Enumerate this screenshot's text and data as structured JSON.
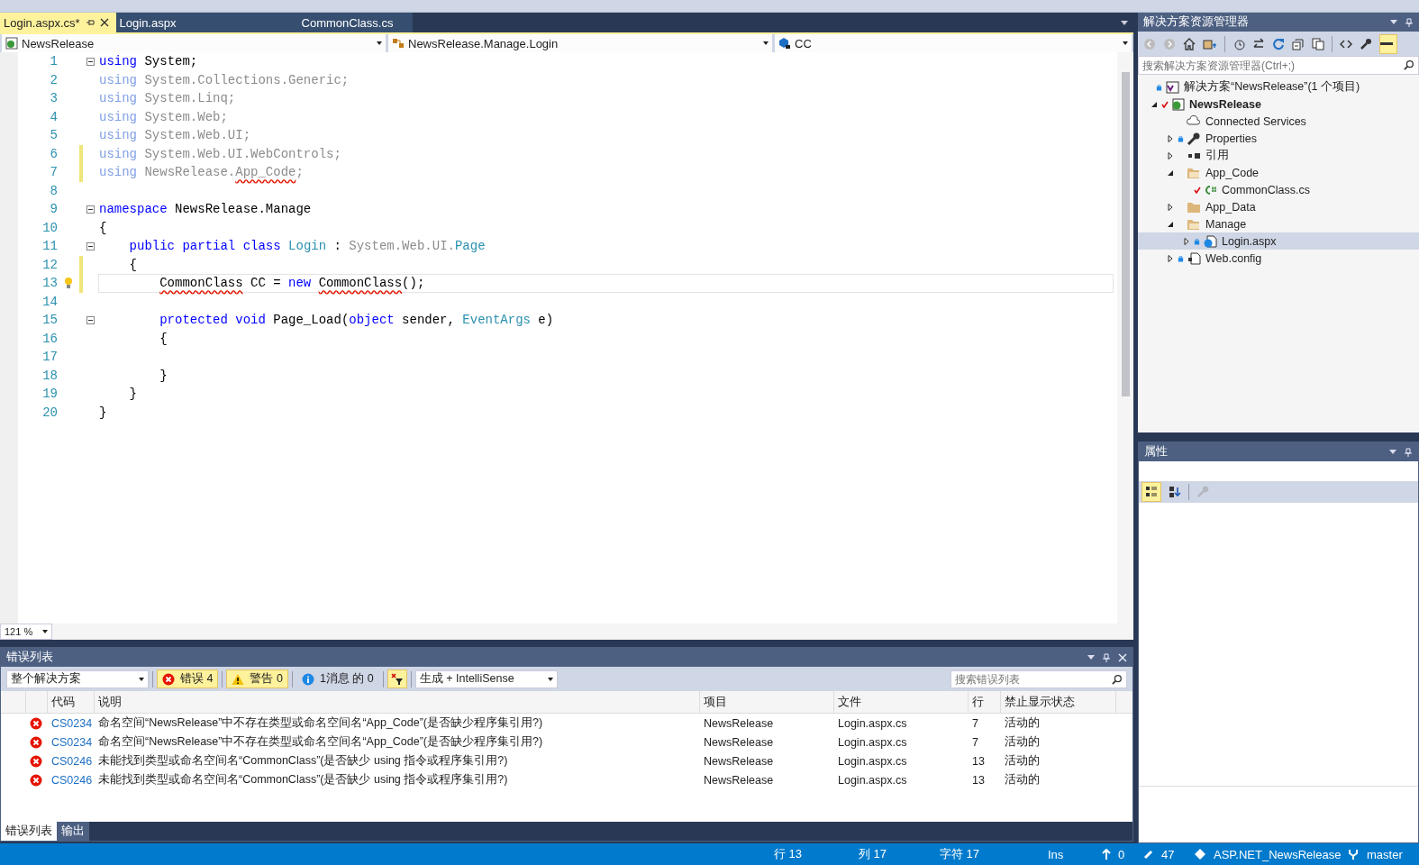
{
  "doc_tabs": [
    {
      "label": "Login.aspx.cs*",
      "selected": true
    },
    {
      "label": "Login.aspx",
      "selected": false
    },
    {
      "label": "CommonClass.cs",
      "selected": false
    }
  ],
  "nav": {
    "project": "NewsRelease",
    "type": "NewsRelease.Manage.Login",
    "member": "CC"
  },
  "code": [
    {
      "n": "1",
      "collapse": true,
      "modified": false,
      "current": false,
      "tokens": [
        {
          "text": "using",
          "kind": "kw"
        },
        {
          "text": " System;",
          "kind": "plain"
        }
      ]
    },
    {
      "n": "2",
      "collapse": false,
      "modified": false,
      "current": false,
      "tokens": [
        {
          "text": "using",
          "kind": "dimkw"
        },
        {
          "text": " System.Collections.Generic;",
          "kind": "dim"
        }
      ]
    },
    {
      "n": "3",
      "collapse": false,
      "modified": false,
      "current": false,
      "tokens": [
        {
          "text": "using",
          "kind": "dimkw"
        },
        {
          "text": " System.Linq;",
          "kind": "dim"
        }
      ]
    },
    {
      "n": "4",
      "collapse": false,
      "modified": false,
      "current": false,
      "tokens": [
        {
          "text": "using",
          "kind": "dimkw"
        },
        {
          "text": " System.Web;",
          "kind": "dim"
        }
      ]
    },
    {
      "n": "5",
      "collapse": false,
      "modified": false,
      "current": false,
      "tokens": [
        {
          "text": "using",
          "kind": "dimkw"
        },
        {
          "text": " System.Web.UI;",
          "kind": "dim"
        }
      ]
    },
    {
      "n": "6",
      "collapse": false,
      "modified": true,
      "current": false,
      "tokens": [
        {
          "text": "using",
          "kind": "dimkw"
        },
        {
          "text": " System.Web.UI.WebControls;",
          "kind": "dim"
        }
      ]
    },
    {
      "n": "7",
      "collapse": false,
      "modified": true,
      "current": false,
      "tokens": [
        {
          "text": "using",
          "kind": "dimkw"
        },
        {
          "text": " NewsRelease.",
          "kind": "dim"
        },
        {
          "text": "App_Code",
          "kind": "dimerr"
        },
        {
          "text": ";",
          "kind": "dim"
        }
      ]
    },
    {
      "n": "8",
      "collapse": false,
      "modified": false,
      "current": false
    },
    {
      "n": "9",
      "collapse": true,
      "modified": false,
      "current": false,
      "tokens": [
        {
          "text": "namespace",
          "kind": "kw"
        },
        {
          "text": " NewsRelease.Manage",
          "kind": "plain"
        }
      ]
    },
    {
      "n": "10",
      "collapse": false,
      "modified": false,
      "current": false,
      "tokens": [
        {
          "text": "{",
          "kind": "plain"
        }
      ]
    },
    {
      "n": "11",
      "collapse": true,
      "modified": false,
      "current": false,
      "tokens": [
        {
          "text": "    public",
          "kind": "kw"
        },
        {
          "text": " partial",
          "kind": "kw"
        },
        {
          "text": " class",
          "kind": "kw"
        },
        {
          "text": " Login",
          "kind": "type"
        },
        {
          "text": " : ",
          "kind": "plain"
        },
        {
          "text": "System.Web.UI.",
          "kind": "dim"
        },
        {
          "text": "Page",
          "kind": "type"
        }
      ]
    },
    {
      "n": "12",
      "collapse": false,
      "modified": true,
      "current": false,
      "tokens": [
        {
          "text": "    {",
          "kind": "plain"
        }
      ]
    },
    {
      "n": "13",
      "collapse": false,
      "modified": true,
      "current": true,
      "lightbulb": true,
      "tokens": [
        {
          "text": "        CommonClass",
          "kind": "err"
        },
        {
          "text": " CC = ",
          "kind": "plain"
        },
        {
          "text": "new",
          "kind": "kw"
        },
        {
          "text": " CommonClass",
          "kind": "err"
        },
        {
          "text": "();",
          "kind": "plain"
        }
      ]
    },
    {
      "n": "14",
      "collapse": false,
      "modified": false,
      "current": false
    },
    {
      "n": "15",
      "collapse": true,
      "modified": false,
      "current": false,
      "tokens": [
        {
          "text": "        protected",
          "kind": "kw"
        },
        {
          "text": " void",
          "kind": "kw"
        },
        {
          "text": " Page_Load(",
          "kind": "plain"
        },
        {
          "text": "object",
          "kind": "kw"
        },
        {
          "text": " sender, ",
          "kind": "plain"
        },
        {
          "text": "EventArgs",
          "kind": "type"
        },
        {
          "text": " e)",
          "kind": "plain"
        }
      ]
    },
    {
      "n": "16",
      "collapse": false,
      "modified": false,
      "current": false,
      "tokens": [
        {
          "text": "        {",
          "kind": "plain"
        }
      ]
    },
    {
      "n": "17",
      "collapse": false,
      "modified": false,
      "current": false
    },
    {
      "n": "18",
      "collapse": false,
      "modified": false,
      "current": false,
      "tokens": [
        {
          "text": "        }",
          "kind": "plain"
        }
      ]
    },
    {
      "n": "19",
      "collapse": false,
      "modified": false,
      "current": false,
      "tokens": [
        {
          "text": "    }",
          "kind": "plain"
        }
      ]
    },
    {
      "n": "20",
      "collapse": false,
      "modified": false,
      "current": false,
      "tokens": [
        {
          "text": "}",
          "kind": "plain"
        }
      ]
    }
  ],
  "zoom": "121 %",
  "solution_explorer": {
    "title": "解决方案资源管理器",
    "search_placeholder": "搜索解决方案资源管理器(Ctrl+;)",
    "tree": [
      {
        "label": "解决方案“NewsRelease”(1 个项目)",
        "kind": "solution",
        "locked": true,
        "changed": false,
        "selected": false,
        "children": [
          {
            "label": "NewsRelease",
            "kind": "project",
            "locked": false,
            "changed": true,
            "expanded": true,
            "selected": false,
            "children": [
              {
                "label": "Connected Services",
                "kind": "cloud",
                "locked": false,
                "changed": false,
                "selected": false
              },
              {
                "label": "Properties",
                "kind": "wrench",
                "locked": true,
                "changed": false,
                "expanded": false,
                "selected": false
              },
              {
                "label": "引用",
                "kind": "refs",
                "locked": false,
                "changed": false,
                "expanded": false,
                "selected": false
              },
              {
                "label": "App_Code",
                "kind": "folder-open",
                "locked": false,
                "changed": false,
                "expanded": true,
                "selected": false,
                "children": [
                  {
                    "label": "CommonClass.cs",
                    "kind": "csharp",
                    "locked": false,
                    "changed": true,
                    "selected": false
                  }
                ]
              },
              {
                "label": "App_Data",
                "kind": "folder",
                "locked": false,
                "changed": false,
                "expanded": false,
                "selected": false
              },
              {
                "label": "Manage",
                "kind": "folder-open",
                "locked": false,
                "changed": false,
                "expanded": true,
                "selected": false,
                "children": [
                  {
                    "label": "Login.aspx",
                    "kind": "page",
                    "locked": true,
                    "changed": false,
                    "expanded": false,
                    "selected": true
                  }
                ]
              },
              {
                "label": "Web.config",
                "kind": "config",
                "locked": true,
                "changed": false,
                "expanded": false,
                "selected": false
              }
            ]
          }
        ]
      }
    ]
  },
  "properties": {
    "title": "属性",
    "tools": [
      {
        "kind": "categorized",
        "selected": true,
        "disabled": false
      },
      {
        "kind": "alphabetical",
        "selected": false,
        "disabled": false
      },
      {
        "kind": "property-pages",
        "selected": false,
        "disabled": true
      }
    ]
  },
  "error_list": {
    "title": "错误列表",
    "scope": "整个解决方案",
    "filters": [
      {
        "kind": "error",
        "label": "错误 4",
        "on": true
      },
      {
        "kind": "warning",
        "label": "警告 0",
        "on": true
      },
      {
        "kind": "info",
        "label": "1消息 的 0",
        "on": false
      }
    ],
    "filter_toggle_on": true,
    "source": "生成 + IntelliSense",
    "search_placeholder": "搜索错误列表",
    "columns": [
      "代码",
      "说明",
      "项目",
      "文件",
      "行",
      "禁止显示状态"
    ],
    "rows": [
      {
        "code": "CS0234",
        "description": "命名空间“NewsRelease”中不存在类型或命名空间名“App_Code”(是否缺少程序集引用?)",
        "project": "NewsRelease",
        "file": "Login.aspx.cs",
        "line": "7",
        "state": "活动的"
      },
      {
        "code": "CS0234",
        "description": "命名空间“NewsRelease”中不存在类型或命名空间名“App_Code”(是否缺少程序集引用?)",
        "project": "NewsRelease",
        "file": "Login.aspx.cs",
        "line": "7",
        "state": "活动的"
      },
      {
        "code": "CS0246",
        "description": "未能找到类型或命名空间名“CommonClass”(是否缺少 using 指令或程序集引用?)",
        "project": "NewsRelease",
        "file": "Login.aspx.cs",
        "line": "13",
        "state": "活动的"
      },
      {
        "code": "CS0246",
        "description": "未能找到类型或命名空间名“CommonClass”(是否缺少 using 指令或程序集引用?)",
        "project": "NewsRelease",
        "file": "Login.aspx.cs",
        "line": "13",
        "state": "活动的"
      }
    ],
    "tabs": [
      {
        "label": "错误列表",
        "selected": true
      },
      {
        "label": "输出",
        "selected": false
      }
    ]
  },
  "status_bar": [
    {
      "kind": "text",
      "text": "行 13"
    },
    {
      "kind": "text",
      "text": "列 17"
    },
    {
      "kind": "text",
      "text": "字符 17"
    },
    {
      "kind": "text",
      "text": "Ins"
    },
    {
      "kind": "push",
      "text": "0"
    },
    {
      "kind": "pencil",
      "text": "47"
    },
    {
      "kind": "repo",
      "text": "ASP.NET_NewsRelease"
    },
    {
      "kind": "branch",
      "text": "master"
    }
  ]
}
